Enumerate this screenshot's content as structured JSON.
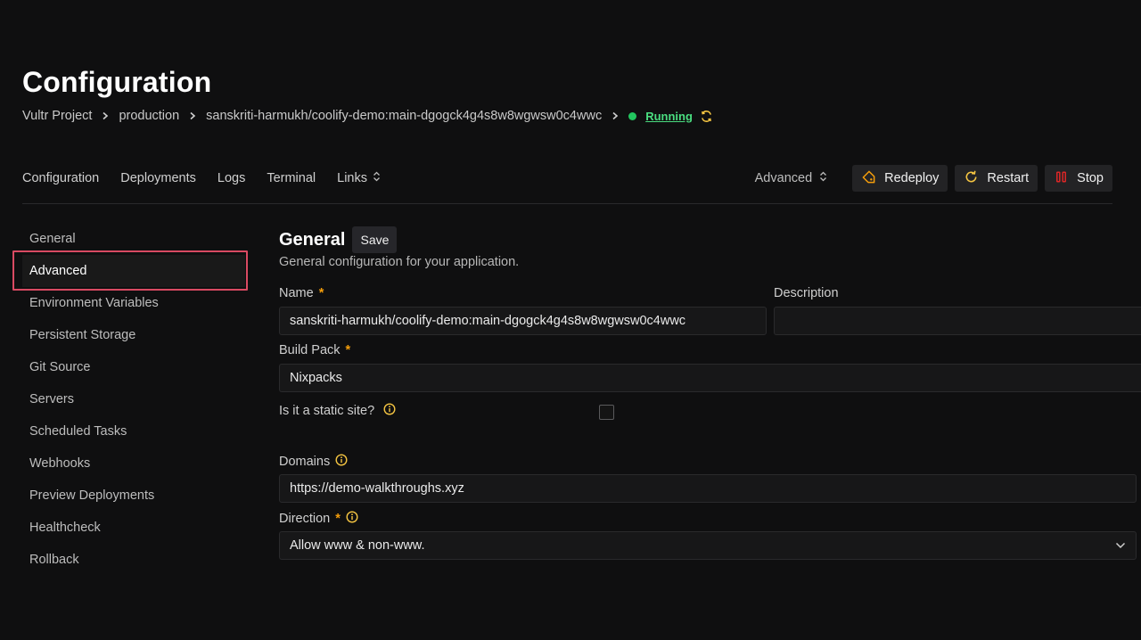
{
  "header": {
    "title": "Configuration",
    "breadcrumb": {
      "project": "Vultr Project",
      "environment": "production",
      "application": "sanskriti-harmukh/coolify-demo:main-dgogck4g4s8w8wgwsw0c4wwc",
      "status": "Running"
    }
  },
  "nav": {
    "tabs": [
      "Configuration",
      "Deployments",
      "Logs",
      "Terminal",
      "Links"
    ],
    "advanced_label": "Advanced",
    "redeploy_label": "Redeploy",
    "restart_label": "Restart",
    "stop_label": "Stop"
  },
  "sidebar": {
    "items": [
      {
        "label": "General"
      },
      {
        "label": "Advanced"
      },
      {
        "label": "Environment Variables"
      },
      {
        "label": "Persistent Storage"
      },
      {
        "label": "Git Source"
      },
      {
        "label": "Servers"
      },
      {
        "label": "Scheduled Tasks"
      },
      {
        "label": "Webhooks"
      },
      {
        "label": "Preview Deployments"
      },
      {
        "label": "Healthcheck"
      },
      {
        "label": "Rollback"
      }
    ],
    "highlighted": "Advanced"
  },
  "general": {
    "title": "General",
    "save_label": "Save",
    "subtitle": "General configuration for your application.",
    "name_label": "Name",
    "name_value": "sanskriti-harmukh/coolify-demo:main-dgogck4g4s8w8wgwsw0c4wwc",
    "description_label": "Description",
    "description_value": "",
    "build_pack_label": "Build Pack",
    "build_pack_value": "Nixpacks",
    "static_site_label": "Is it a static site?",
    "static_site_checked": false,
    "domains_label": "Domains",
    "domains_value": "https://demo-walkthroughs.xyz",
    "direction_label": "Direction",
    "direction_value": "Allow www & non-www.",
    "required_mark": "*"
  },
  "colors": {
    "background": "#0f0f10",
    "status_green": "#22c55e",
    "accent_orange": "#f59e0b",
    "stop_red": "#dc2626",
    "highlight_border": "#d94a62"
  },
  "icons": [
    "chevron-right-icon",
    "refresh-icon",
    "up-down-icon",
    "tag-icon",
    "restart-icon",
    "stop-icon",
    "info-icon",
    "chevron-down-icon"
  ]
}
